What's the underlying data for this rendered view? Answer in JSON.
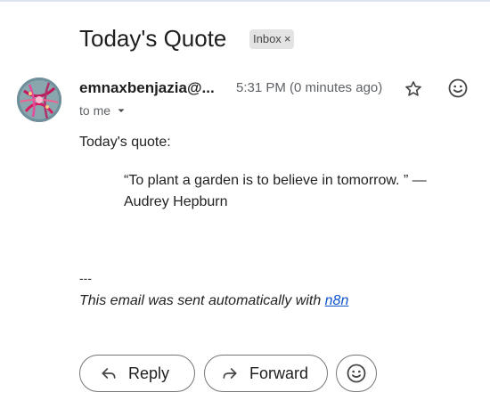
{
  "email": {
    "subject": "Today's Quote",
    "label": "Inbox",
    "label_remove": "×",
    "sender": "emnaxbenjazia@...",
    "time": "5:31 PM (0 minutes ago)",
    "recipient": "to me",
    "greeting": "Today's quote:",
    "quote": "“To plant a garden is to believe in tomorrow. ” — Audrey Hepburn",
    "signature_separator": "---",
    "signature_text": "This email was sent automatically with ",
    "signature_link": "n8n"
  },
  "actions": {
    "reply_label": "Reply",
    "forward_label": "Forward"
  },
  "icons": {
    "star": "star-icon",
    "emoji": "emoji-icon",
    "dropdown": "chevron-down-icon",
    "reply": "reply-arrow-icon",
    "forward": "forward-arrow-icon"
  }
}
